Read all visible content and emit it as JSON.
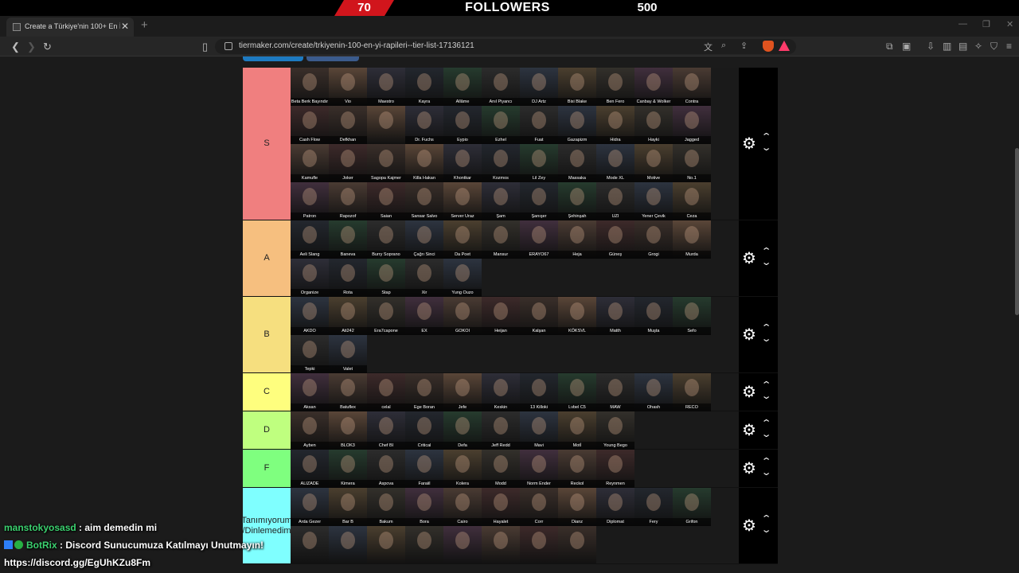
{
  "overlay": {
    "current": "70",
    "label": "FOLLOWERS",
    "goal": "500",
    "progress_fraction": 0.14
  },
  "browser": {
    "tab_title": "Create a Türkiye'nin 100+ En İyi",
    "url": "tiermaker.com/create/trkiyenin-100-en-yi-rapileri--tier-list-17136121"
  },
  "colors": {
    "S": "#f07f7f",
    "A": "#f6bf7f",
    "B": "#f6df7f",
    "C": "#fefe7e",
    "D": "#bfff7f",
    "F": "#7fff7f",
    "U": "#7fffff"
  },
  "tiers": [
    {
      "id": "S",
      "label": "S",
      "items": [
        "Beta Berk Bayındır",
        "Vio",
        "Maestro",
        "Kayra",
        "Allâme",
        "Anıl Piyancı",
        "DJ Artz",
        "Bixi Blake",
        "Ben Fero",
        "Canbay & Wolker",
        "Contra",
        "Cash Flow",
        "Defkhan",
        "",
        "Dr. Fuchs",
        "Eypio",
        "Ezhel",
        "Fuat",
        "Gazapizm",
        "Hidra",
        "Hayki",
        "Jagged",
        "Kamufle",
        "Joker",
        "Sagopa Kajmer",
        "Killa Hakan",
        "Khontkar",
        "Kozmos",
        "Lil Zey",
        "Massaka",
        "Mode XL",
        "Motive",
        "No.1",
        "Patron",
        "Rapozof",
        "Saian",
        "Sansar Salvo",
        "Server Uraz",
        "Şam",
        "Şanışer",
        "Şehinşah",
        "UZI",
        "Yener Çevik",
        "Ceza"
      ]
    },
    {
      "id": "A",
      "label": "A",
      "items": [
        "Aeli Slang",
        "Baneva",
        "Burry Soprano",
        "Çağrı Sinci",
        "Da Poet",
        "Mansur",
        "ERAYO67",
        "Heja",
        "Güneş",
        "Grogi",
        "Murda",
        "Organize",
        "Rota",
        "Stap",
        "Xir",
        "Yung Ouzo"
      ]
    },
    {
      "id": "B",
      "label": "B",
      "items": [
        "AKDO",
        "Ati242",
        "Era7capone",
        "EX",
        "GOKOI",
        "Heijan",
        "Kalşan",
        "KÖKSVL",
        "Matth",
        "Muşta",
        "Sefo",
        "Tepki",
        "Valet"
      ]
    },
    {
      "id": "C",
      "label": "C",
      "items": [
        "Aksan",
        "Batuflex",
        "celal",
        "Ege Boran",
        "Jefe",
        "Keskin",
        "13 Killoki",
        "Lvbel C5",
        "MAW",
        "Ohash",
        "RECO"
      ]
    },
    {
      "id": "D",
      "label": "D",
      "items": [
        "Ayben",
        "BLOK3",
        "Chef BI",
        "Critical",
        "Defa",
        "Jeff Redd",
        "Mavi",
        "Motİ",
        "Young Bego"
      ]
    },
    {
      "id": "F",
      "label": "F",
      "items": [
        "ALIZADE",
        "Kimera",
        "Aspova",
        "Faraiil",
        "Kolera",
        "Modd",
        "Norm Ender",
        "Reckol",
        "Reynmen"
      ]
    },
    {
      "id": "U",
      "label": "Tanımıyorum /Dinlemedim",
      "items": [
        "Arda Gezer",
        "Bar B",
        "Bakum",
        "Bora",
        "Cairo",
        "Hayalet",
        "Corr",
        "Dianz",
        "Diplomat",
        "Fery",
        "Grifon",
        "",
        "",
        "",
        "",
        "",
        "",
        "",
        ""
      ]
    }
  ],
  "chat": [
    {
      "user": "manstokyosasd",
      "message": ": aim demedin mi"
    },
    {
      "user": "BotRix",
      "message": ": Discord Sunucumuza Katılmayı Unutmayın!"
    },
    {
      "user": "",
      "message": "https://discord.gg/EgUhKZu8Fm"
    }
  ],
  "icons": {
    "gear": "gear-icon",
    "up": "chevron-up-icon",
    "down": "chevron-down-icon"
  }
}
